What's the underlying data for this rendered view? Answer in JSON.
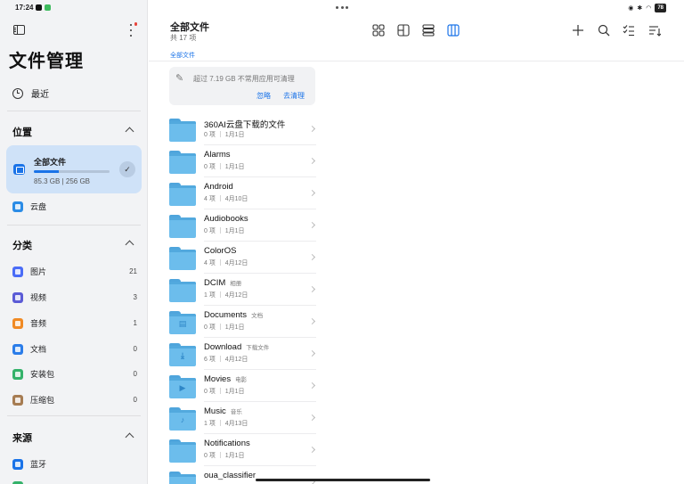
{
  "status_bar": {
    "time": "17:24",
    "battery": "78"
  },
  "sidebar": {
    "title": "文件管理",
    "recent_label": "最近",
    "location_title": "位置",
    "storage": {
      "name": "全部文件",
      "size_text": "85.3 GB | 256 GB",
      "used_fraction": 0.333
    },
    "cloud_label": "云盘",
    "category_title": "分类",
    "categories": [
      {
        "label": "图片",
        "count": "21",
        "color": "#4a6cf7"
      },
      {
        "label": "视频",
        "count": "3",
        "color": "#5b5bd6"
      },
      {
        "label": "音频",
        "count": "1",
        "color": "#f08a24"
      },
      {
        "label": "文档",
        "count": "0",
        "color": "#2b7de9"
      },
      {
        "label": "安装包",
        "count": "0",
        "color": "#34b26a"
      },
      {
        "label": "压缩包",
        "count": "0",
        "color": "#a67c52"
      }
    ],
    "source_title": "来源",
    "sources": [
      {
        "label": "蓝牙",
        "color": "#1a73e8"
      }
    ]
  },
  "main": {
    "title": "全部文件",
    "subtitle": "共 17 项",
    "breadcrumb": "全部文件",
    "banner": {
      "text": "超过 7.19 GB 不常用应用可清理",
      "ignore": "忽略",
      "clean": "去清理"
    },
    "files": [
      {
        "name": "360AI云盘下载的文件",
        "tag": "",
        "meta": "0 项 ｜ 1月1日",
        "glyph": ""
      },
      {
        "name": "Alarms",
        "tag": "",
        "meta": "0 项 ｜ 1月1日",
        "glyph": ""
      },
      {
        "name": "Android",
        "tag": "",
        "meta": "4 项 ｜ 4月10日",
        "glyph": ""
      },
      {
        "name": "Audiobooks",
        "tag": "",
        "meta": "0 项 ｜ 1月1日",
        "glyph": ""
      },
      {
        "name": "ColorOS",
        "tag": "",
        "meta": "4 项 ｜ 4月12日",
        "glyph": ""
      },
      {
        "name": "DCIM",
        "tag": "相册",
        "meta": "1 项 ｜ 4月12日",
        "glyph": ""
      },
      {
        "name": "Documents",
        "tag": "文档",
        "meta": "0 项 ｜ 1月1日",
        "glyph": "▤"
      },
      {
        "name": "Download",
        "tag": "下载文件",
        "meta": "6 项 ｜ 4月12日",
        "glyph": "⤓"
      },
      {
        "name": "Movies",
        "tag": "电影",
        "meta": "0 项 ｜ 1月1日",
        "glyph": "▶"
      },
      {
        "name": "Music",
        "tag": "音乐",
        "meta": "1 项 ｜ 4月13日",
        "glyph": "♪"
      },
      {
        "name": "Notifications",
        "tag": "",
        "meta": "0 项 ｜ 1月1日",
        "glyph": ""
      },
      {
        "name": "oua_classifier",
        "tag": "",
        "meta": "",
        "glyph": ""
      }
    ]
  },
  "icons": {
    "colors": {
      "accent": "#1a73e8",
      "folder": "#6cbdec"
    }
  }
}
